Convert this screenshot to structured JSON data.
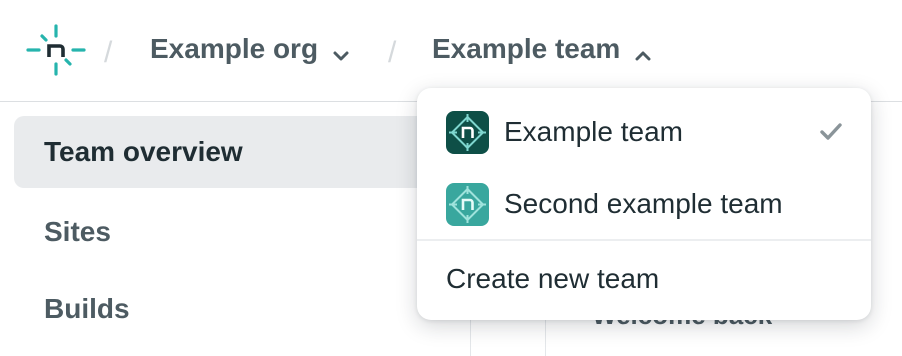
{
  "header": {
    "logo_icon": "netlify-logo-icon",
    "separator": "/",
    "org": {
      "label": "Example org",
      "icon": "chevron-down-icon"
    },
    "team": {
      "label": "Example team",
      "icon": "chevron-up-icon"
    }
  },
  "sidebar": {
    "items": [
      {
        "label": "Team overview",
        "active": true
      },
      {
        "label": "Sites",
        "active": false
      },
      {
        "label": "Builds",
        "active": false
      }
    ]
  },
  "main": {
    "welcome_text": "Welcome back"
  },
  "team_dropdown": {
    "teams": [
      {
        "label": "Example team",
        "selected": true,
        "avatar_color": "#0e4f47",
        "icon": "team-avatar-icon"
      },
      {
        "label": "Second example team",
        "selected": false,
        "avatar_color": "#39a79e",
        "icon": "team-avatar-icon"
      }
    ],
    "check_icon": "checkmark-icon",
    "create_label": "Create new team"
  },
  "colors": {
    "brand_teal": "#26b4ad",
    "active_bg": "#e9ebed",
    "text_muted": "#4d5b62",
    "text_dark": "#1f2d33"
  }
}
